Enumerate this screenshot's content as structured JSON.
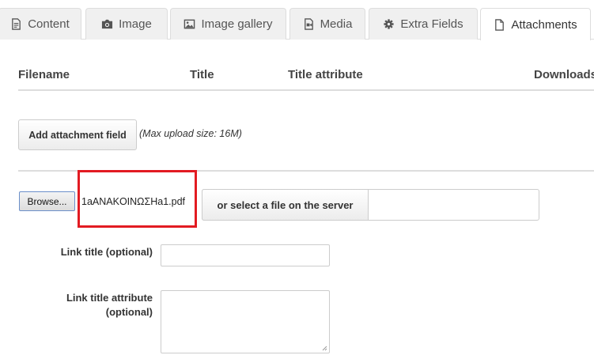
{
  "tabs": [
    {
      "label": "Content",
      "icon": "document-text-icon",
      "active": false
    },
    {
      "label": "Image",
      "icon": "camera-icon",
      "active": false
    },
    {
      "label": "Image gallery",
      "icon": "picture-icon",
      "active": false
    },
    {
      "label": "Media",
      "icon": "film-icon",
      "active": false
    },
    {
      "label": "Extra Fields",
      "icon": "gear-icon",
      "active": false
    },
    {
      "label": "Attachments",
      "icon": "file-icon",
      "active": true
    }
  ],
  "table": {
    "headers": [
      "Filename",
      "Title",
      "Title attribute",
      "Downloads"
    ]
  },
  "add_attachment": {
    "button_label": "Add attachment field",
    "max_upload_hint": "(Max upload size: 16M)"
  },
  "file_row": {
    "browse_label": "Browse...",
    "selected_filename": "1aANAKOINΩΣHa1.pdf",
    "server_button_label": "or select a file on the server",
    "server_path_value": ""
  },
  "link_title": {
    "label": "Link title (optional)",
    "value": ""
  },
  "link_title_attribute": {
    "label_line1": "Link title attribute",
    "label_line2": "(optional)",
    "value": ""
  },
  "colors": {
    "highlight": "#e21b22",
    "tab_inactive_bg": "#f0f0f0",
    "border": "#dddddd"
  }
}
